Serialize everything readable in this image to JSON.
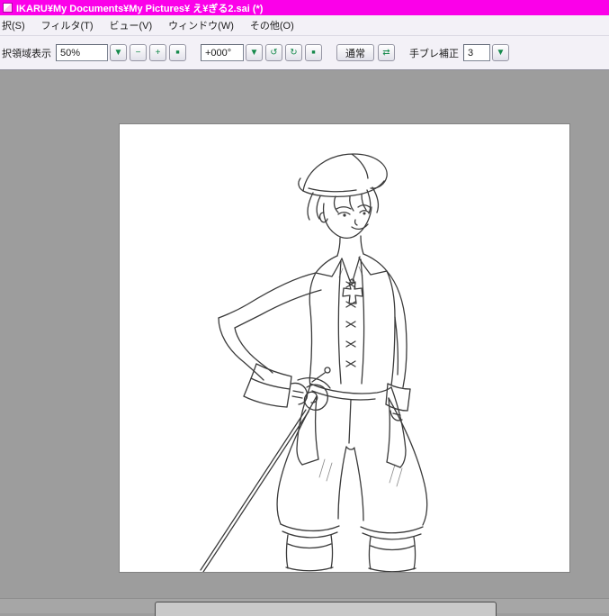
{
  "window": {
    "title": "IKARU¥My Documents¥My Pictures¥ え¥ぎる2.sai (*)"
  },
  "menu_bar": {
    "items": [
      {
        "label": "択(S)"
      },
      {
        "label": "フィルタ(T)"
      },
      {
        "label": "ビュー(V)"
      },
      {
        "label": "ウィンドウ(W)"
      },
      {
        "label": "その他(O)"
      }
    ]
  },
  "toolbar": {
    "selection_label": "択領域表示",
    "zoom": {
      "value": "50%",
      "dropdown": "▼",
      "zoom_out": "−",
      "zoom_in": "+",
      "reset": "■"
    },
    "angle": {
      "value": "+000°",
      "dropdown": "▼",
      "rotate_ccw": "↺",
      "rotate_cw": "↻",
      "reset": "■"
    },
    "view_mode": "通常",
    "flip_icon": "⇄",
    "stabilizer": {
      "label": "手ブレ補正",
      "value": "3",
      "dropdown": "▼"
    }
  },
  "canvas": {
    "zoom_percent": "50%",
    "angle": "+000°",
    "description": "Monochrome line-art sketch of a smiling pirate character in a tricorn hat with a cross pendant, one hand on hip wearing a flared gauntlet, holding a rapier angled to the lower left, baggy breeches and boots"
  },
  "colors": {
    "title_bar": "#fb00e9",
    "menu_bg": "#f3f1f7",
    "workspace_bg": "#9d9d9d",
    "canvas_bg": "#ffffff",
    "button_glyph": "#14894b",
    "sketch_line": "#3b3b3b"
  }
}
